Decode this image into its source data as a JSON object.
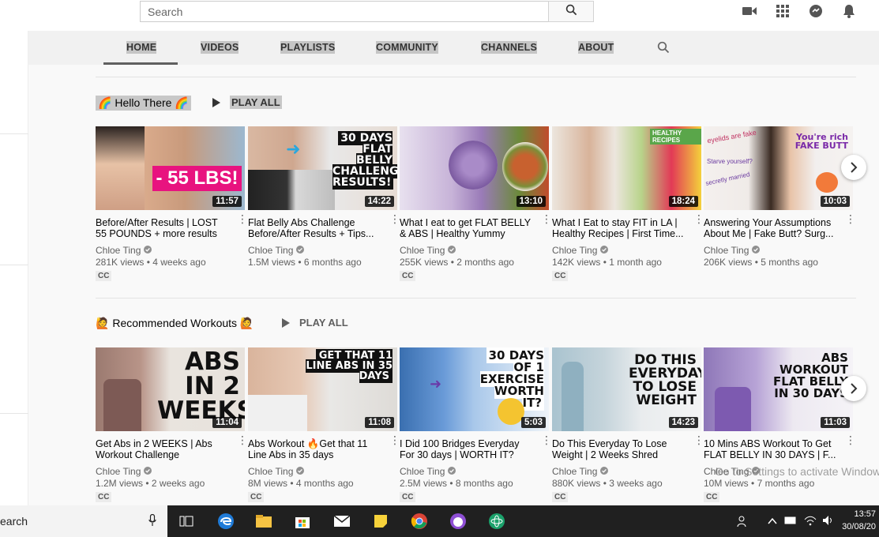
{
  "masthead": {
    "search_placeholder": "Search",
    "icons": [
      "search-icon",
      "create-video-icon",
      "apps-grid-icon",
      "messages-icon",
      "notifications-bell-icon"
    ]
  },
  "tabs": [
    {
      "label": "HOME",
      "selected": true
    },
    {
      "label": "VIDEOS"
    },
    {
      "label": "PLAYLISTS"
    },
    {
      "label": "COMMUNITY"
    },
    {
      "label": "CHANNELS"
    },
    {
      "label": "ABOUT"
    }
  ],
  "shelves": [
    {
      "title": "Hello There",
      "emoji": "🌈",
      "play_all": "PLAY ALL",
      "videos": [
        {
          "thumb_text": "- 55 LBS!",
          "duration": "11:57",
          "title": "Before/After Results | LOST 55 POUNDS + more results",
          "channel": "Chloe Ting",
          "views": "281K views",
          "age": "4 weeks ago",
          "cc": "CC"
        },
        {
          "thumb_text": "30 DAYS FLAT BELLY CHALLENGE RESULTS!",
          "duration": "14:22",
          "title": "Flat Belly Abs Challenge Before/After Results + Tips...",
          "channel": "Chloe Ting",
          "views": "1.5M views",
          "age": "6 months ago",
          "cc": ""
        },
        {
          "thumb_text": "",
          "duration": "13:10",
          "title": "What I eat to get FLAT BELLY & ABS | Healthy Yummy Rec...",
          "channel": "Chloe Ting",
          "views": "255K views",
          "age": "2 months ago",
          "cc": "CC"
        },
        {
          "thumb_text": "HEALTHY RECIPES",
          "duration": "18:24",
          "title": "What I Eat to stay FIT in LA | Healthy Recipes | First Time...",
          "channel": "Chloe Ting",
          "views": "142K views",
          "age": "1 month ago",
          "cc": "CC"
        },
        {
          "thumb_text": "You're rich FAKE BUTT",
          "duration": "10:03",
          "title": "Answering Your Assumptions About Me | Fake Butt? Surg...",
          "channel": "Chloe Ting",
          "views": "206K views",
          "age": "5 months ago",
          "cc": ""
        }
      ]
    },
    {
      "title": "Recommended Workouts",
      "emoji": "🙋",
      "play_all": "PLAY ALL",
      "videos": [
        {
          "thumb_text": "ABS IN 2 WEEKS!",
          "duration": "11:04",
          "title": "Get Abs in 2 WEEKS | Abs Workout Challenge",
          "channel": "Chloe Ting",
          "views": "1.2M views",
          "age": "2 weeks ago",
          "cc": "CC"
        },
        {
          "thumb_text": "GET THAT 11 LINE ABS IN 35 DAYS",
          "duration": "11:08",
          "title": "Abs Workout 🔥Get that 11 Line Abs in 35 days",
          "channel": "Chloe Ting",
          "views": "8M views",
          "age": "4 months ago",
          "cc": "CC"
        },
        {
          "thumb_text": "30 DAYS OF 1 EXERCISE WORTH IT?",
          "duration": "5:03",
          "title": "I Did 100 Bridges Everyday For 30 days | WORTH IT? BE...",
          "channel": "Chloe Ting",
          "views": "2.5M views",
          "age": "8 months ago",
          "cc": "CC"
        },
        {
          "thumb_text": "DO THIS EVERYDAY TO LOSE WEIGHT",
          "duration": "14:23",
          "title": "Do This Everyday To Lose Weight | 2 Weeks Shred Cha...",
          "channel": "Chloe Ting",
          "views": "880K views",
          "age": "3 weeks ago",
          "cc": "CC"
        },
        {
          "thumb_text": "ABS WORKOUT FLAT BELLY IN 30 DAYS",
          "duration": "11:03",
          "title": "10 Mins ABS Workout To Get FLAT BELLY IN 30 DAYS | F...",
          "channel": "Chloe Ting",
          "views": "10M views",
          "age": "7 months ago",
          "cc": "CC"
        }
      ]
    }
  ],
  "watermark": "Go to Settings to activate Windows.",
  "taskbar": {
    "search_text": "earch",
    "time": "13:57",
    "date": "30/08/20"
  },
  "colors": {
    "accent": "#606060",
    "duration_bg": "#000000",
    "taskbar_bg": "#202020"
  }
}
